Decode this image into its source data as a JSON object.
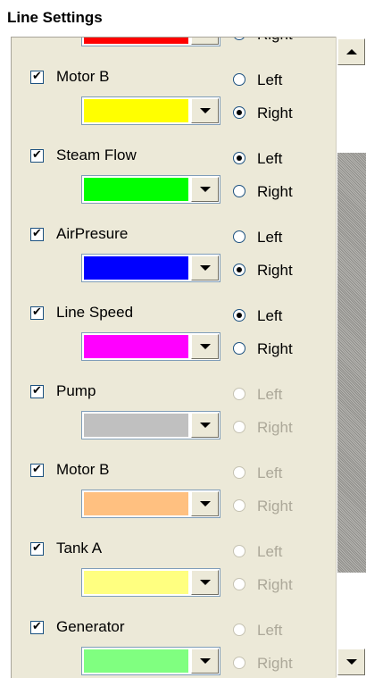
{
  "title": "Line Settings",
  "items": [
    {
      "label": "",
      "color": "#ff0000",
      "left": "",
      "right": "Right",
      "selected": "right",
      "enabled": true,
      "partial": true
    },
    {
      "label": "Motor B",
      "color": "#ffff00",
      "left": "Left",
      "right": "Right",
      "selected": "right",
      "enabled": true
    },
    {
      "label": "Steam Flow",
      "color": "#00ff00",
      "left": "Left",
      "right": "Right",
      "selected": "left",
      "enabled": true
    },
    {
      "label": "AirPresure",
      "color": "#0000ff",
      "left": "Left",
      "right": "Right",
      "selected": "right",
      "enabled": true
    },
    {
      "label": "Line Speed",
      "color": "#ff00ff",
      "left": "Left",
      "right": "Right",
      "selected": "left",
      "enabled": true
    },
    {
      "label": "Pump",
      "color": "#c0c0c0",
      "left": "Left",
      "right": "Right",
      "selected": "",
      "enabled": false
    },
    {
      "label": "Motor B",
      "color": "#ffc080",
      "left": "Left",
      "right": "Right",
      "selected": "",
      "enabled": false
    },
    {
      "label": "Tank A",
      "color": "#ffff80",
      "left": "Left",
      "right": "Right",
      "selected": "",
      "enabled": false
    },
    {
      "label": "Generator",
      "color": "#80ff80",
      "left": "Left",
      "right": "Right",
      "selected": "",
      "enabled": false
    }
  ],
  "icons": {
    "checkbox": "checkmark-icon",
    "dropdown": "chevron-down-icon",
    "scroll_up": "triangle-up-icon",
    "scroll_down": "triangle-down-icon"
  }
}
